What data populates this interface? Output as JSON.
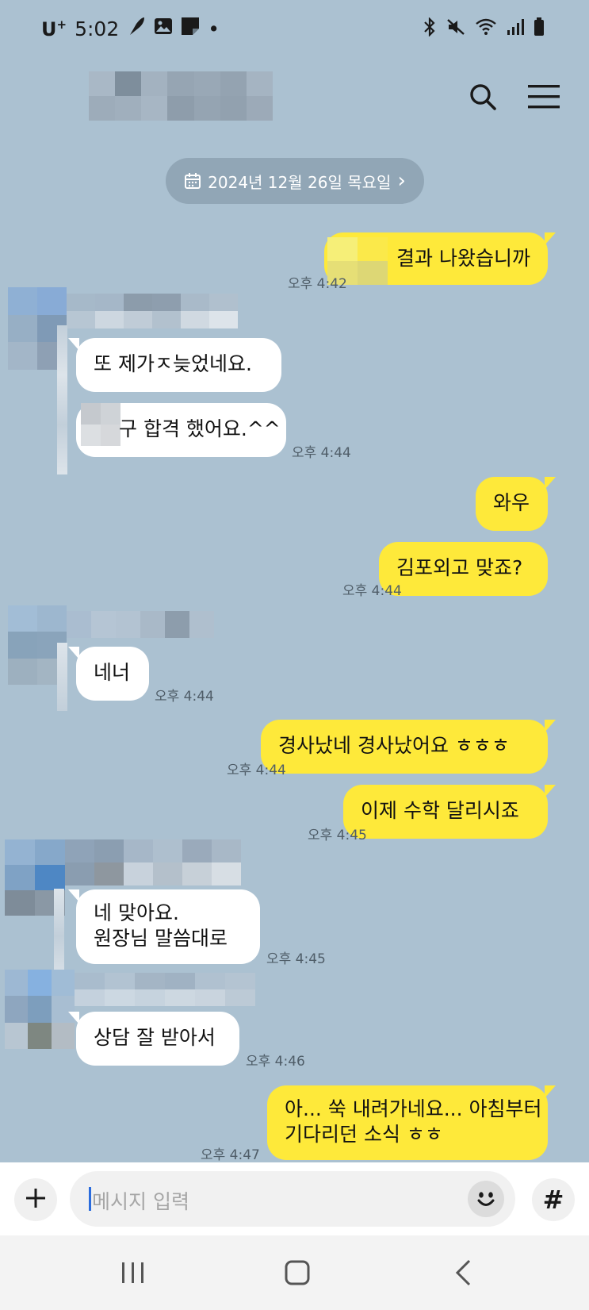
{
  "status_bar": {
    "carrier": "U",
    "carrier_sup": "+",
    "time": "5:02",
    "dot": "•"
  },
  "header": {
    "room_title_obscured": true,
    "search_icon": "search-icon",
    "menu_icon": "menu-icon"
  },
  "date_divider": {
    "text": "2024년 12월 26일 목요일",
    "icon": "calendar-icon",
    "chevron": "›"
  },
  "messages": [
    {
      "sender": "me",
      "text": "결과 나왔습니까",
      "time": "오후 4:42"
    },
    {
      "sender": "them",
      "text": "또 제가ㅈ늦었네요."
    },
    {
      "sender": "them",
      "text": "구 합격 했어요.^^",
      "time": "오후 4:44"
    },
    {
      "sender": "me",
      "text": "와우"
    },
    {
      "sender": "me",
      "text": "김포외고 맞죠?",
      "time": "오후 4:44"
    },
    {
      "sender": "them",
      "text": "네너",
      "time": "오후 4:44"
    },
    {
      "sender": "me",
      "text": "경사났네 경사났어요 ㅎㅎㅎ",
      "time": "오후 4:44"
    },
    {
      "sender": "me",
      "text": "이제 수학 달리시죠",
      "time": "오후 4:45"
    },
    {
      "sender": "them",
      "line1": "네 맞아요.",
      "line2": "원장님 말씀대로",
      "time": "오후 4:45"
    },
    {
      "sender": "them",
      "text": "상담 잘 받아서",
      "time": "오후 4:46"
    },
    {
      "sender": "me",
      "line1": "아... 쑥 내려가네요... 아침부터",
      "line2": "기다리던 소식 ㅎㅎ",
      "time": "오후 4:47"
    }
  ],
  "input_bar": {
    "placeholder": "메시지 입력",
    "plus": "+",
    "hash": "#"
  },
  "colors": {
    "background": "#abc1d1",
    "my_bubble": "#fee93a",
    "their_bubble": "#ffffff",
    "date_pill": "#91a6b6"
  }
}
